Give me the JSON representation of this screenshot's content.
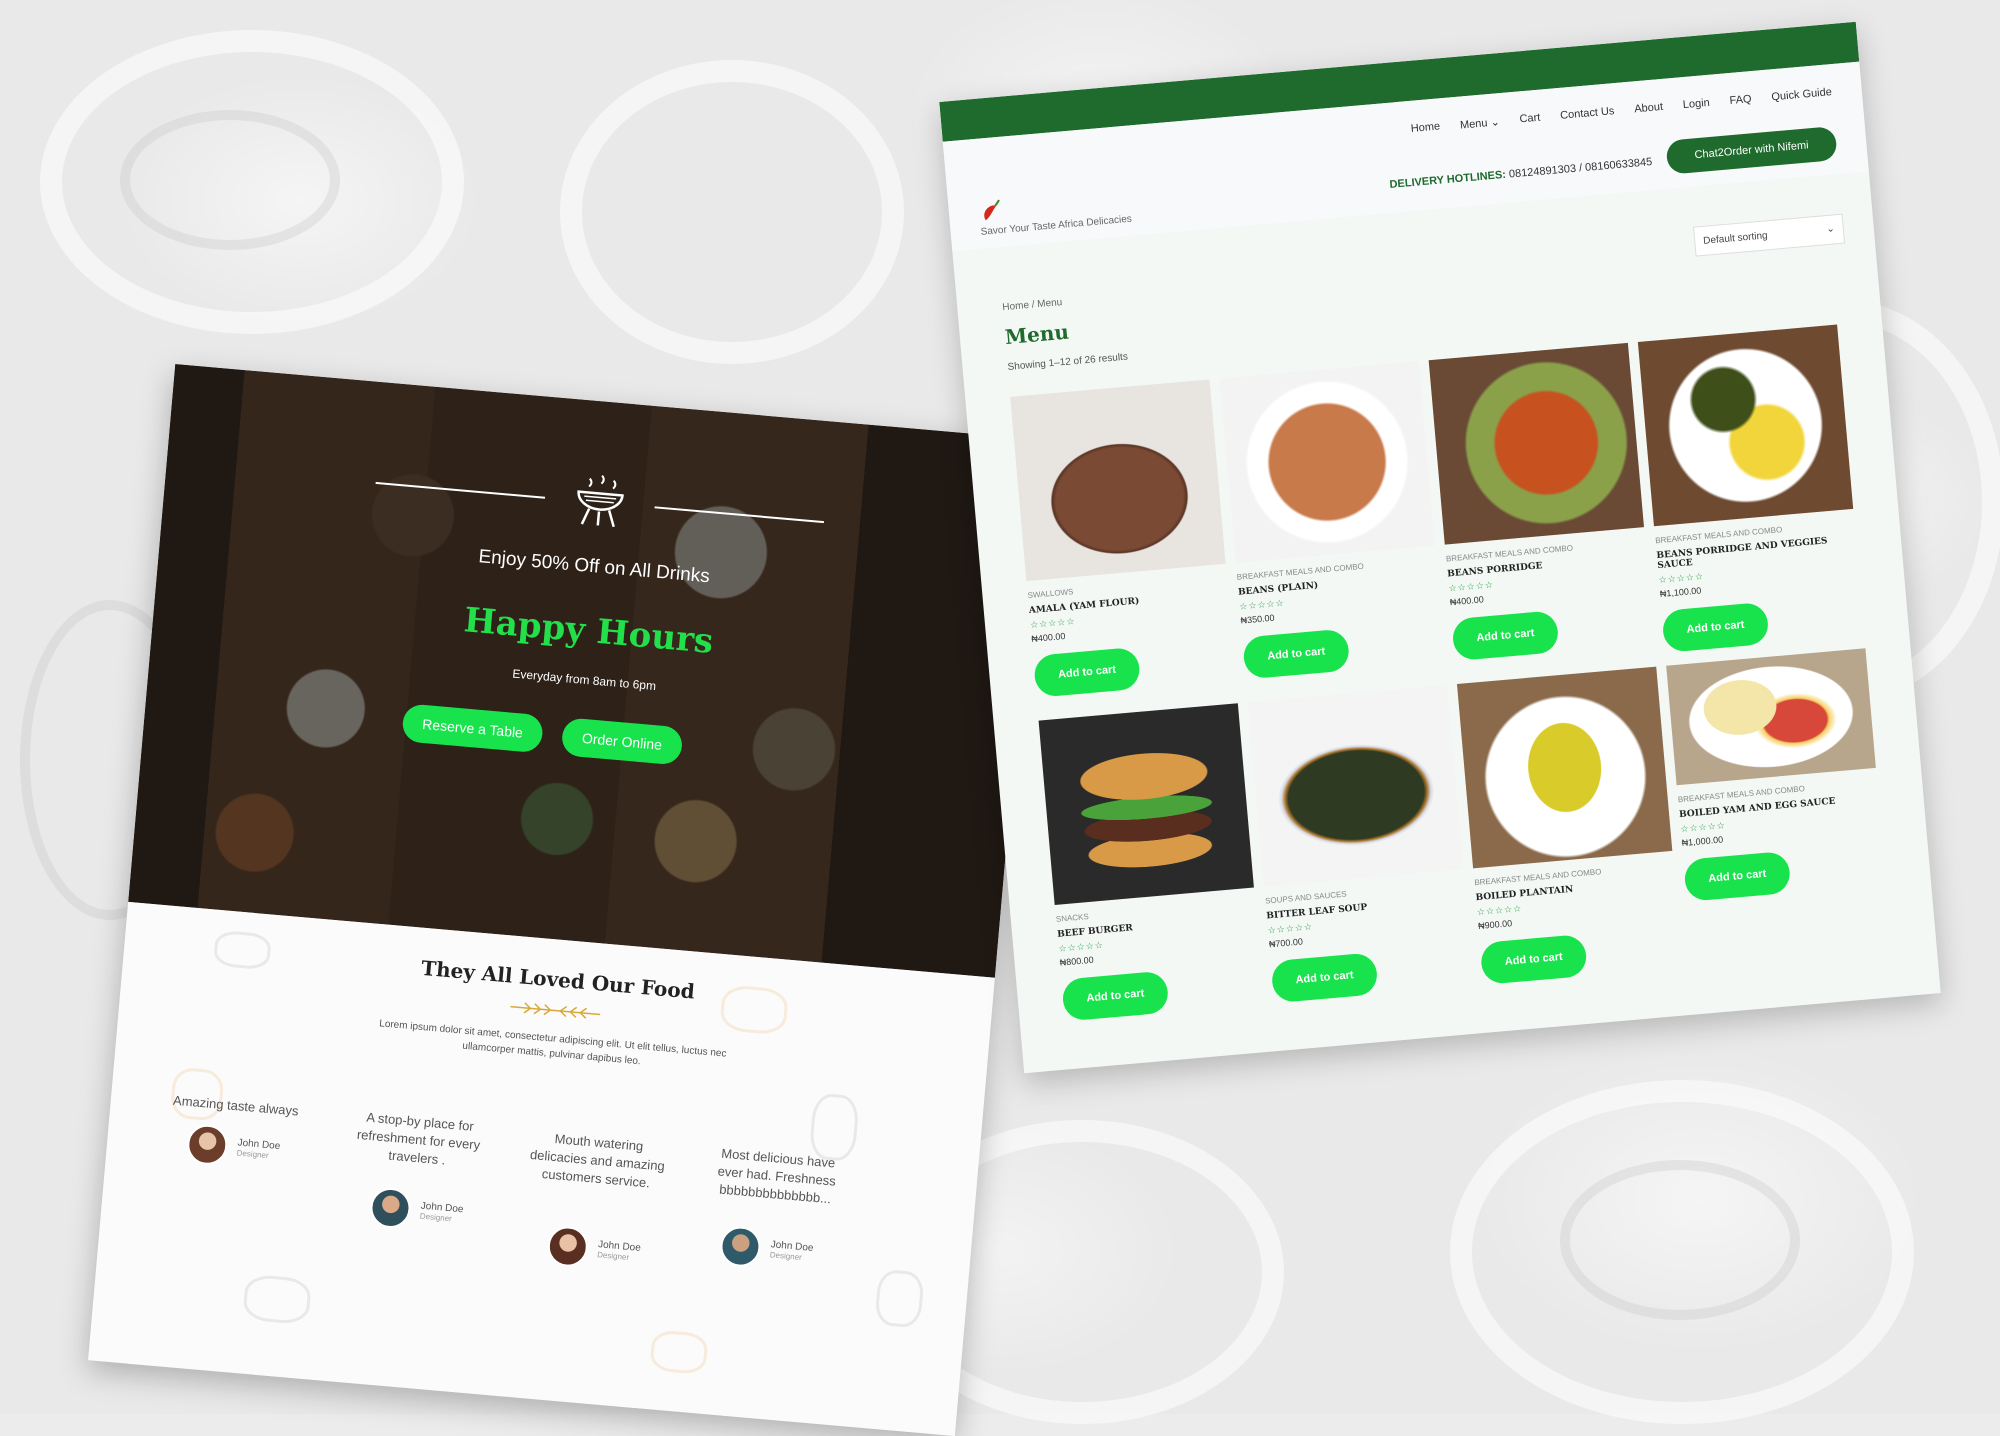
{
  "colors": {
    "brand_green": "#1f6a2d",
    "accent_green": "#18e34c",
    "headline_green": "#22e04a"
  },
  "left": {
    "offer": "Enjoy 50% Off on All Drinks",
    "headline": "Happy Hours",
    "subline": "Everyday from 8am to 6pm",
    "reserve_label": "Reserve a Table",
    "order_label": "Order Online",
    "section_title": "They All Loved Our Food",
    "section_text": "Lorem ipsum dolor sit amet, consectetur adipiscing elit. Ut elit tellus, luctus nec ullamcorper mattis, pulvinar dapibus leo.",
    "testimonials": [
      {
        "quote": "Amazing taste always",
        "name": "John Doe",
        "role": "Designer"
      },
      {
        "quote": "A stop-by place for refreshment for every travelers .",
        "name": "John Doe",
        "role": "Designer"
      },
      {
        "quote": "Mouth watering delicacies and amazing customers service.",
        "name": "John Doe",
        "role": "Designer"
      },
      {
        "quote": "Most delicious have ever had. Freshness bbbbbbbbbbbbbb...",
        "name": "John Doe",
        "role": "Designer"
      }
    ]
  },
  "right": {
    "nav": [
      "Home",
      "Menu",
      "Cart",
      "Contact Us",
      "About",
      "Login",
      "FAQ",
      "Quick Guide"
    ],
    "chat_label": "Chat2Order with Nifemi",
    "hotline_label": "DELIVERY HOTLINES:",
    "hotline_numbers": "08124891303 / 08160633845",
    "tagline": "Savor Your Taste Africa Delicacies",
    "breadcrumb": "Home / Menu",
    "sorting": "Default sorting",
    "title": "Menu",
    "showing": "Showing 1–12 of 26 results",
    "stars": "☆☆☆☆☆",
    "add_label": "Add to cart",
    "products": [
      {
        "category": "Swallows",
        "name": "AMALA (YAM FLOUR)",
        "price": "₦400.00"
      },
      {
        "category": "Breakfast Meals and Combo",
        "name": "BEANS (PLAIN)",
        "price": "₦350.00"
      },
      {
        "category": "Breakfast Meals and Combo",
        "name": "BEANS PORRIDGE",
        "price": "₦400.00"
      },
      {
        "category": "Breakfast Meals and Combo",
        "name": "BEANS PORRIDGE AND VEGGIES SAUCE",
        "price": "₦1,100.00"
      },
      {
        "category": "Snacks",
        "name": "BEEF BURGER",
        "price": "₦800.00"
      },
      {
        "category": "Soups and Sauces",
        "name": "BITTER LEAF SOUP",
        "price": "₦700.00"
      },
      {
        "category": "Breakfast Meals and Combo",
        "name": "BOILED PLANTAIN",
        "price": "₦900.00"
      },
      {
        "category": "Breakfast Meals and Combo",
        "name": "BOILED YAM AND EGG SAUCE",
        "price": "₦1,000.00"
      }
    ]
  }
}
